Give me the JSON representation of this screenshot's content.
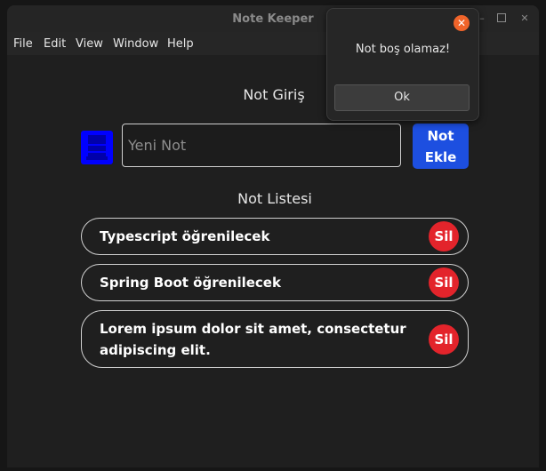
{
  "window": {
    "title": "Note Keeper",
    "minimize_glyph": "–",
    "close_glyph": "✕"
  },
  "menu": {
    "items": [
      "File",
      "Edit",
      "View",
      "Window",
      "Help"
    ]
  },
  "form": {
    "heading": "Not Giriş",
    "input_placeholder": "Yeni Not",
    "input_value": "",
    "add_button_line1": "Not",
    "add_button_line2": "Ekle",
    "icon": "note-icon"
  },
  "list": {
    "heading": "Not Listesi",
    "items": [
      {
        "line1": "Typescript öğrenilecek",
        "line2": "",
        "delete_label": "Sil"
      },
      {
        "line1": "Spring Boot öğrenilecek",
        "line2": "",
        "delete_label": "Sil"
      },
      {
        "line1": "Lorem ipsum dolor sit amet, consectetur",
        "line2": "adipiscing elit.",
        "delete_label": "Sil"
      }
    ]
  },
  "dialog": {
    "message": "Not boş olamaz!",
    "ok_label": "Ok",
    "close_glyph": "✕"
  },
  "colors": {
    "background": "#1f1f1f",
    "accent_blue": "#1d4fe0",
    "icon_blue": "#0000ff",
    "delete_red": "#e3242b",
    "dialog_close_orange": "#f0642a"
  }
}
